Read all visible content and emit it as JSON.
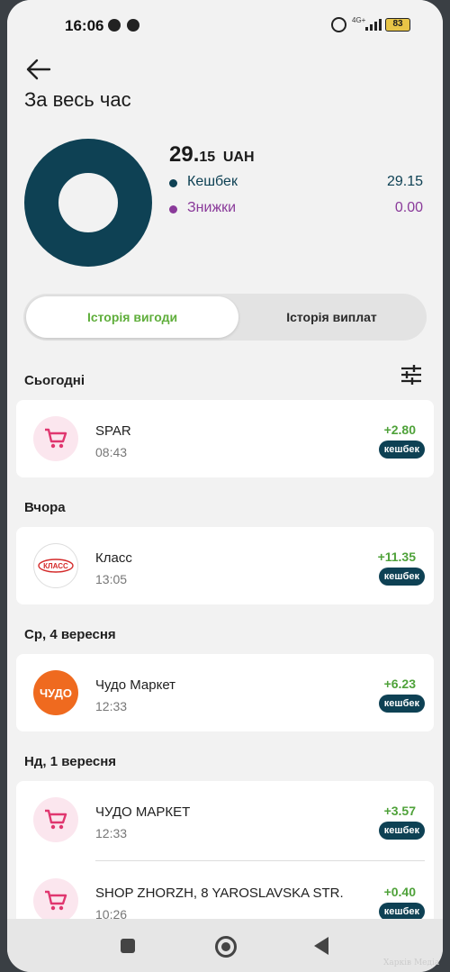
{
  "status_bar": {
    "time": "16:06",
    "network": "4G+",
    "battery": "83"
  },
  "page": {
    "title": "За весь час"
  },
  "summary": {
    "total_int": "29.",
    "total_dec": "15",
    "currency": "UAH",
    "legend": [
      {
        "label": "Кешбек",
        "value": "29.15",
        "color": "#0e4154"
      },
      {
        "label": "Знижки",
        "value": "0.00",
        "color": "#8a3a9a"
      }
    ]
  },
  "tabs": {
    "active": "Історія вигоди",
    "inactive": "Історія виплат"
  },
  "groups": [
    {
      "day": "Сьогодні",
      "items": [
        {
          "name": "SPAR",
          "time": "08:43",
          "amount": "+2.80",
          "badge": "кешбек",
          "logo": "cart-icon"
        }
      ]
    },
    {
      "day": "Вчора",
      "items": [
        {
          "name": "Класс",
          "time": "13:05",
          "amount": "+11.35",
          "badge": "кешбек",
          "logo": "klass-logo",
          "logo_text": "КЛАСС"
        }
      ]
    },
    {
      "day": "Ср, 4 вересня",
      "items": [
        {
          "name": "Чудо Маркет",
          "time": "12:33",
          "amount": "+6.23",
          "badge": "кешбек",
          "logo": "chudo-logo",
          "logo_text": "ЧУДО"
        }
      ]
    },
    {
      "day": "Нд, 1 вересня",
      "items": [
        {
          "name": "ЧУДО МАРКЕТ",
          "time": "12:33",
          "amount": "+3.57",
          "badge": "кешбек",
          "logo": "cart-icon"
        },
        {
          "name": "SHOP ZHORZH, 8  YAROSLAVSKA STR.",
          "time": "10:26",
          "amount": "+0.40",
          "badge": "кешбек",
          "logo": "cart-icon"
        }
      ]
    }
  ],
  "watermark": "Харків Медіа"
}
